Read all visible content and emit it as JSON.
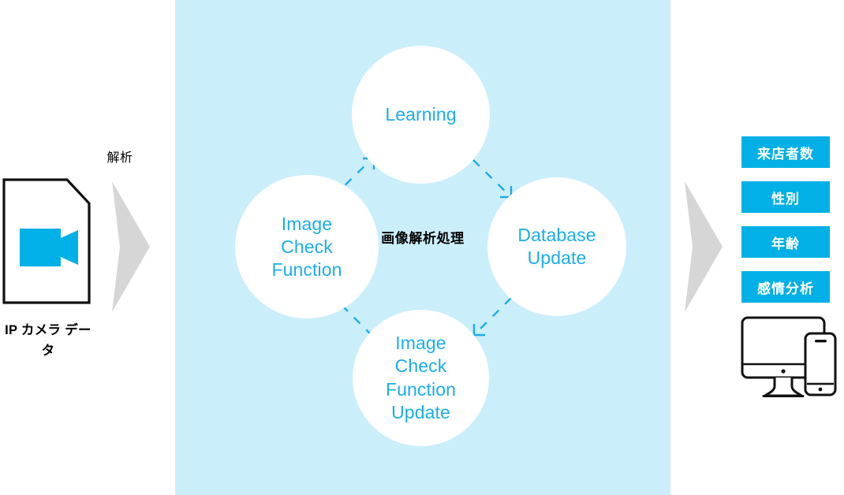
{
  "diagram": {
    "title_caption": "画像解析処理",
    "background_accent": "#cbeefb",
    "accent_color": "#1badea",
    "badge_color": "#00b0e6",
    "arrow_gray": "#d4d4d4"
  },
  "source": {
    "icon": "video-camera-document-icon",
    "label": "IP カメラ\nデータ",
    "flow_label": "解析",
    "flow_icon": "chevron-right-arrow"
  },
  "cycle": {
    "caption": "画像解析処理",
    "nodes": [
      {
        "id": "learning",
        "label": "Learning",
        "position": "top"
      },
      {
        "id": "image-check-function",
        "label": "Image\nCheck\nFunction",
        "position": "left"
      },
      {
        "id": "database-update",
        "label": "Database\nUpdate",
        "position": "right"
      },
      {
        "id": "image-check-function-update",
        "label": "Image\nCheck\nFunction\nUpdate",
        "position": "bottom"
      }
    ],
    "connectors": [
      {
        "from": "image-check-function",
        "to": "learning",
        "style": "dashed-arrow"
      },
      {
        "from": "learning",
        "to": "database-update",
        "style": "dashed-arrow"
      },
      {
        "from": "database-update",
        "to": "image-check-function-update",
        "style": "dashed-arrow"
      },
      {
        "from": "image-check-function-update",
        "to": "image-check-function",
        "style": "dashed-arrow"
      }
    ]
  },
  "output": {
    "flow_icon": "chevron-right-arrow",
    "badges": [
      {
        "label": "来店者数"
      },
      {
        "label": "性別"
      },
      {
        "label": "年齢"
      },
      {
        "label": "感情分析"
      }
    ],
    "devices_icon": "monitor-and-smartphone-icon"
  }
}
